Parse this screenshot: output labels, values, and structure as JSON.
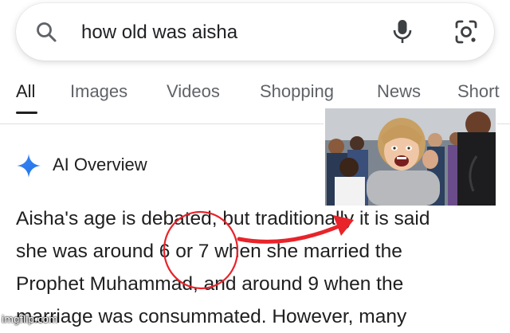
{
  "search": {
    "query": "how old was aisha",
    "search_icon": "search-icon",
    "mic_icon": "microphone-icon",
    "lens_icon": "camera-lens-icon"
  },
  "tabs": [
    {
      "label": "All",
      "active": true
    },
    {
      "label": "Images",
      "active": false
    },
    {
      "label": "Videos",
      "active": false
    },
    {
      "label": "Shopping",
      "active": false
    },
    {
      "label": "News",
      "active": false
    },
    {
      "label": "Short",
      "active": false
    }
  ],
  "ai_overview": {
    "icon": "sparkle-icon",
    "label": "AI Overview",
    "lines": [
      "Aisha's age is debated, but traditionally it is said",
      "she was around 6 or 7 when she married the",
      "Prophet Muhammad, and around 9 when the",
      "marriage was consummated. However, many"
    ]
  },
  "reaction_image": {
    "description_icon": "reaction-photo"
  },
  "annotation": {
    "color": "#e8232a"
  },
  "colors": {
    "accent_blue": "#4285f4",
    "mic_gray": "#3c4043",
    "tab_gray": "#5f6368"
  },
  "watermark": "imgflip.com"
}
